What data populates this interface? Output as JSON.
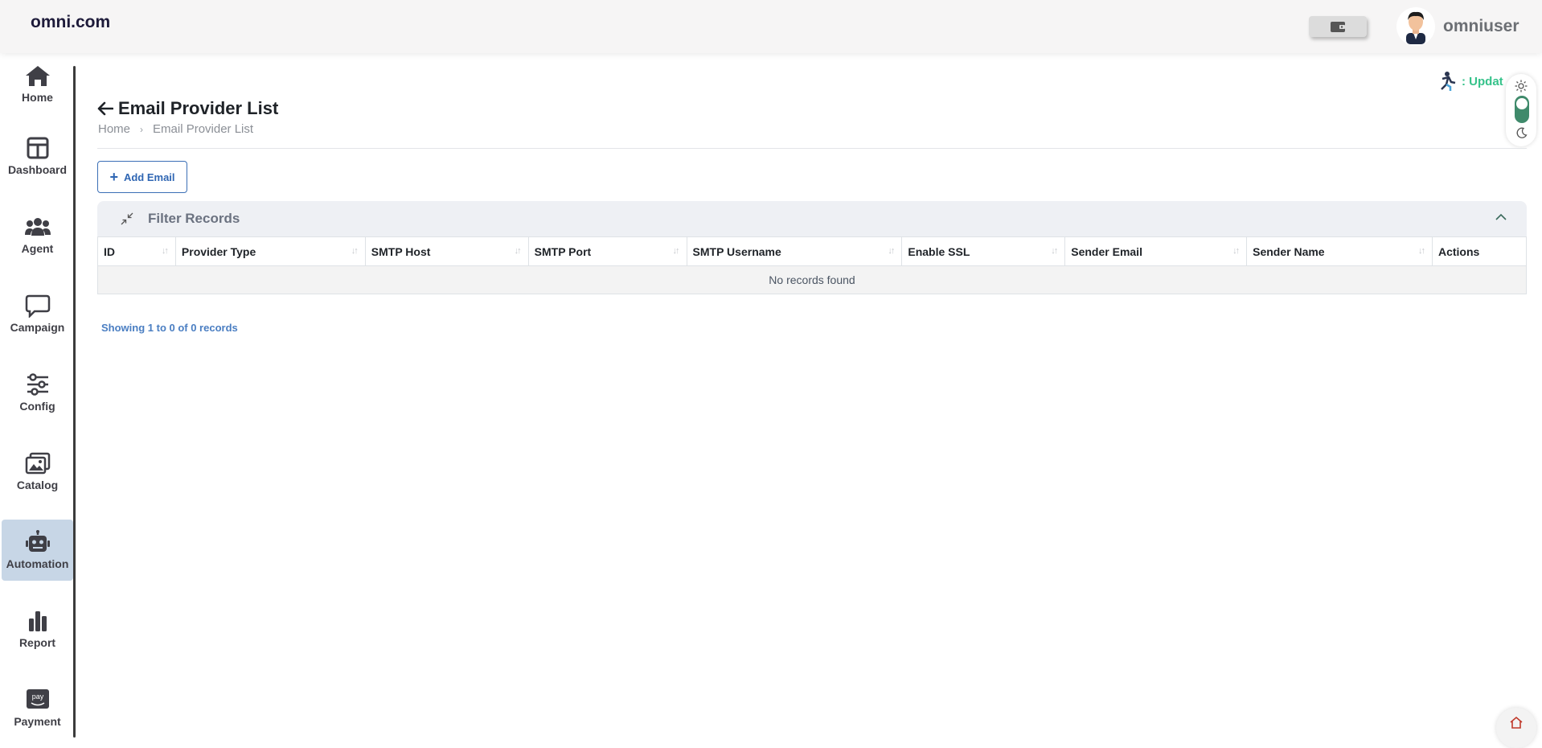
{
  "header": {
    "brand": "omni.com",
    "username": "omniuser"
  },
  "sidebar": {
    "items": [
      {
        "label": "Home",
        "icon": "home-icon"
      },
      {
        "label": "Dashboard",
        "icon": "dashboard-icon"
      },
      {
        "label": "Agent",
        "icon": "agent-icon"
      },
      {
        "label": "Campaign",
        "icon": "campaign-icon"
      },
      {
        "label": "Config",
        "icon": "config-icon"
      },
      {
        "label": "Catalog",
        "icon": "catalog-icon"
      },
      {
        "label": "Automation",
        "icon": "automation-icon",
        "active": true
      },
      {
        "label": "Report",
        "icon": "report-icon"
      },
      {
        "label": "Payment",
        "icon": "payment-icon"
      }
    ],
    "active_color": "#c7d6e6"
  },
  "status": {
    "update_text": ": Updat"
  },
  "page": {
    "title": "Email Provider List",
    "breadcrumb": [
      "Home",
      "Email Provider List"
    ]
  },
  "toolbar": {
    "add_label": "Add Email",
    "accent_color": "#2f66b3"
  },
  "filter": {
    "title": "Filter Records"
  },
  "table": {
    "columns": [
      "ID",
      "Provider Type",
      "SMTP Host",
      "SMTP Port",
      "SMTP Username",
      "Enable SSL",
      "Sender Email",
      "Sender Name",
      "Actions"
    ],
    "empty_message": "No records found"
  },
  "footer": {
    "records_info": "Showing 1 to 0 of 0 records"
  }
}
